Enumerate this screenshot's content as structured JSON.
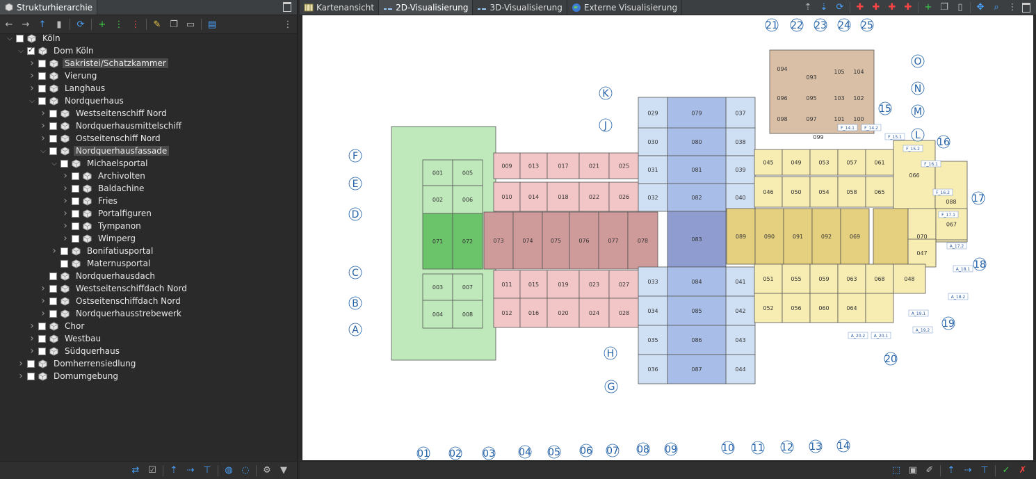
{
  "left_panel": {
    "title": "Strukturhierarchie",
    "tree": [
      {
        "label": "Köln",
        "level": 0,
        "arrow": "down",
        "checked": false
      },
      {
        "label": "Dom Köln",
        "level": 1,
        "arrow": "down",
        "checked": true
      },
      {
        "label": "Sakristei/Schatzkammer",
        "level": 2,
        "arrow": "right",
        "checked": false,
        "selected": true
      },
      {
        "label": "Vierung",
        "level": 2,
        "arrow": "right",
        "checked": false
      },
      {
        "label": "Langhaus",
        "level": 2,
        "arrow": "right",
        "checked": false
      },
      {
        "label": "Nordquerhaus",
        "level": 2,
        "arrow": "down",
        "checked": false
      },
      {
        "label": "Westseitenschiff Nord",
        "level": 3,
        "arrow": "right",
        "checked": false
      },
      {
        "label": "Nordquerhausmittelschiff",
        "level": 3,
        "arrow": "right",
        "checked": false
      },
      {
        "label": "Ostseitenschiff Nord",
        "level": 3,
        "arrow": "right",
        "checked": false
      },
      {
        "label": "Nordquerhausfassade",
        "level": 3,
        "arrow": "down",
        "checked": false,
        "selected": true
      },
      {
        "label": "Michaelsportal",
        "level": 4,
        "arrow": "down",
        "checked": false
      },
      {
        "label": "Archivolten",
        "level": 5,
        "arrow": "right",
        "checked": false
      },
      {
        "label": "Baldachine",
        "level": 5,
        "arrow": "right",
        "checked": false
      },
      {
        "label": "Fries",
        "level": 5,
        "arrow": "right",
        "checked": false
      },
      {
        "label": "Portalfiguren",
        "level": 5,
        "arrow": "right",
        "checked": false
      },
      {
        "label": "Tympanon",
        "level": 5,
        "arrow": "right",
        "checked": false
      },
      {
        "label": "Wimperg",
        "level": 5,
        "arrow": "right",
        "checked": false
      },
      {
        "label": "Bonifatiusportal",
        "level": 4,
        "arrow": "right",
        "checked": false
      },
      {
        "label": "Maternusportal",
        "level": 4,
        "arrow": "none",
        "checked": false
      },
      {
        "label": "Nordquerhausdach",
        "level": 3,
        "arrow": "none",
        "checked": false
      },
      {
        "label": "Westseitenschiffdach Nord",
        "level": 3,
        "arrow": "right",
        "checked": false
      },
      {
        "label": "Ostseitenschiffdach Nord",
        "level": 3,
        "arrow": "right",
        "checked": false
      },
      {
        "label": "Nordquerhausstrebewerk",
        "level": 3,
        "arrow": "right",
        "checked": false
      },
      {
        "label": "Chor",
        "level": 2,
        "arrow": "right",
        "checked": false
      },
      {
        "label": "Westbau",
        "level": 2,
        "arrow": "right",
        "checked": false
      },
      {
        "label": "Südquerhaus",
        "level": 2,
        "arrow": "right",
        "checked": false
      },
      {
        "label": "Domherrensiedlung",
        "level": 1,
        "arrow": "right",
        "checked": false
      },
      {
        "label": "Domumgebung",
        "level": 1,
        "arrow": "right",
        "checked": false
      }
    ]
  },
  "right_panel": {
    "tabs": [
      {
        "label": "Kartenansicht",
        "icon": "map-icon"
      },
      {
        "label": "2D-Visualisierung",
        "icon": "2d-icon",
        "active": true
      },
      {
        "label": "3D-Visualisierung",
        "icon": "3d-icon"
      },
      {
        "label": "Externe Visualisierung",
        "icon": "globe-icon"
      }
    ]
  },
  "plan": {
    "axis_top": [
      "21",
      "22",
      "23",
      "24",
      "25"
    ],
    "axis_bottom": [
      "01",
      "02",
      "03",
      "04",
      "05",
      "06",
      "07",
      "08",
      "09",
      "10",
      "11",
      "12",
      "13",
      "14"
    ],
    "axis_left": [
      "F",
      "E",
      "D",
      "C",
      "B",
      "A"
    ],
    "axis_mid": [
      "K",
      "J",
      "H",
      "G"
    ],
    "axis_right_letters": [
      "O",
      "N",
      "M",
      "L"
    ],
    "axis_right_numbers": [
      "15",
      "16",
      "17",
      "18",
      "19",
      "20"
    ],
    "small_tags": [
      "F_14.1",
      "F_14.2",
      "F_15.1",
      "F_15.2",
      "F_16.1",
      "F_16.2",
      "F_17.1",
      "A_17.2",
      "A_18.1",
      "A_18.2",
      "A_19.1",
      "A_19.2",
      "A_20.1",
      "A_20.2"
    ],
    "rooms": {
      "green": [
        "001",
        "005",
        "002",
        "006",
        "071",
        "072",
        "003",
        "007",
        "004",
        "008"
      ],
      "pink": [
        "009",
        "013",
        "017",
        "021",
        "025",
        "010",
        "014",
        "018",
        "022",
        "026",
        "073",
        "074",
        "075",
        "076",
        "077",
        "078",
        "011",
        "015",
        "019",
        "023",
        "027",
        "012",
        "016",
        "020",
        "024",
        "028"
      ],
      "light_blue": [
        "029",
        "030",
        "031",
        "032",
        "033",
        "034",
        "035",
        "036",
        "037",
        "038",
        "039",
        "040",
        "041",
        "042",
        "043",
        "044"
      ],
      "blue": [
        "079",
        "080",
        "081",
        "082",
        "083",
        "084",
        "085",
        "086",
        "087"
      ],
      "yellow": [
        "045",
        "049",
        "053",
        "057",
        "061",
        "046",
        "050",
        "054",
        "058",
        "065",
        "066",
        "088",
        "089",
        "090",
        "091",
        "092",
        "069",
        "070",
        "067",
        "047",
        "051",
        "055",
        "059",
        "063",
        "068",
        "048",
        "052",
        "056",
        "060",
        "064"
      ],
      "brown": [
        "094",
        "093",
        "105",
        "104",
        "096",
        "095",
        "103",
        "102",
        "098",
        "097",
        "101",
        "100",
        "099"
      ]
    }
  },
  "colors": {
    "green": "#bfe8bb",
    "green_dark": "#6cc46a",
    "pink": "#f2c6c6",
    "pink_dark": "#cf9a9a",
    "light_blue": "#cfe0f5",
    "blue": "#a8bde8",
    "blue_dark": "#8e9ccf",
    "yellow": "#f7edb3",
    "yellow_dark": "#e4d07f",
    "brown": "#d9bfa6",
    "axis_text": "#1f5fa6"
  }
}
